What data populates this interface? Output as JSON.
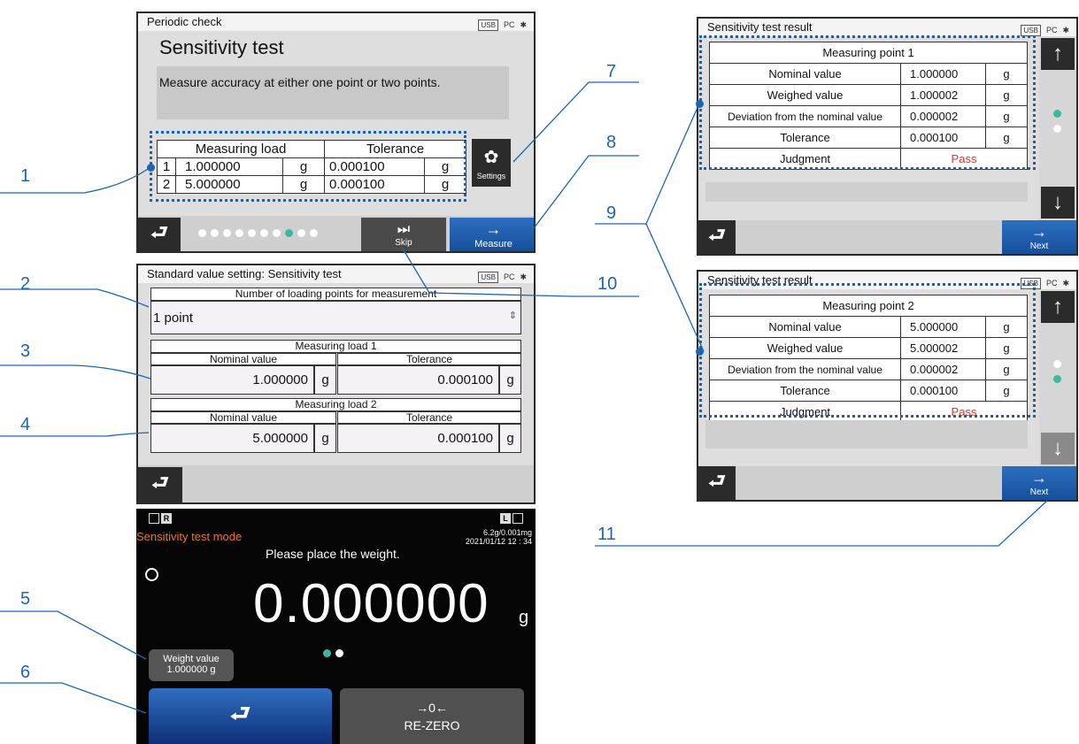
{
  "callouts": [
    "1",
    "2",
    "3",
    "4",
    "5",
    "6",
    "7",
    "8",
    "9",
    "10",
    "11"
  ],
  "status_icons": {
    "usb": "USB",
    "pc": "PC"
  },
  "periodic": {
    "header": "Periodic check",
    "title": "Sensitivity test",
    "description": "Measure accuracy at either one point or two points.",
    "table_headers": [
      "Measuring load",
      "Tolerance"
    ],
    "rows": [
      {
        "index": "1",
        "load": "1.000000",
        "load_unit": "g",
        "tol": "0.000100",
        "tol_unit": "g"
      },
      {
        "index": "2",
        "load": "5.000000",
        "load_unit": "g",
        "tol": "0.000100",
        "tol_unit": "g"
      }
    ],
    "settings_label": "Settings",
    "skip_label": "Skip",
    "measure_label": "Measure",
    "page_dots": 10,
    "active_dot": 7
  },
  "standard": {
    "header": "Standard value setting: Sensitivity test",
    "points_label": "Number of loading points for measurement",
    "points_value": "1 point",
    "load1_label": "Measuring load 1",
    "load2_label": "Measuring load 2",
    "nominal_label": "Nominal value",
    "tolerance_label": "Tolerance",
    "load1_nominal": "1.000000",
    "load1_tolerance": "0.000100",
    "load2_nominal": "5.000000",
    "load2_tolerance": "0.000100",
    "unit": "g"
  },
  "mode": {
    "side_left": "R",
    "side_right": "L",
    "mode_label": "Sensitivity test mode",
    "capacity": "6.2g/0.001mg",
    "datetime": "2021/01/12   12 : 34",
    "instruction": "Please place the weight.",
    "reading": "0.000000",
    "reading_unit": "g",
    "weight_label": "Weight value",
    "weight_value": "1.000000  g",
    "rezero_symbol": "→0←",
    "rezero_label": "RE-ZERO"
  },
  "result1": {
    "header": "Sensitivity test result",
    "point_label": "Measuring point 1",
    "rows": [
      {
        "label": "Nominal value",
        "value": "1.000000",
        "unit": "g"
      },
      {
        "label": "Weighed value",
        "value": "1.000002",
        "unit": "g"
      },
      {
        "label": "Deviation from the nominal value",
        "value": "0.000002",
        "unit": "g"
      },
      {
        "label": "Tolerance",
        "value": "0.000100",
        "unit": "g"
      }
    ],
    "judgment_label": "Judgment",
    "judgment_value": "Pass",
    "next_label": "Next"
  },
  "result2": {
    "header": "Sensitivity test result",
    "point_label": "Measuring point 2",
    "rows": [
      {
        "label": "Nominal value",
        "value": "5.000000",
        "unit": "g"
      },
      {
        "label": "Weighed value",
        "value": "5.000002",
        "unit": "g"
      },
      {
        "label": "Deviation from the nominal value",
        "value": "0.000002",
        "unit": "g"
      },
      {
        "label": "Tolerance",
        "value": "0.000100",
        "unit": "g"
      }
    ],
    "judgment_label": "Judgment",
    "judgment_value": "Pass",
    "next_label": "Next"
  },
  "colors": {
    "accent": "#1a66b5",
    "pass": "#e53030",
    "dot_active": "#3cb8a0",
    "mode_label": "#e8782a"
  }
}
